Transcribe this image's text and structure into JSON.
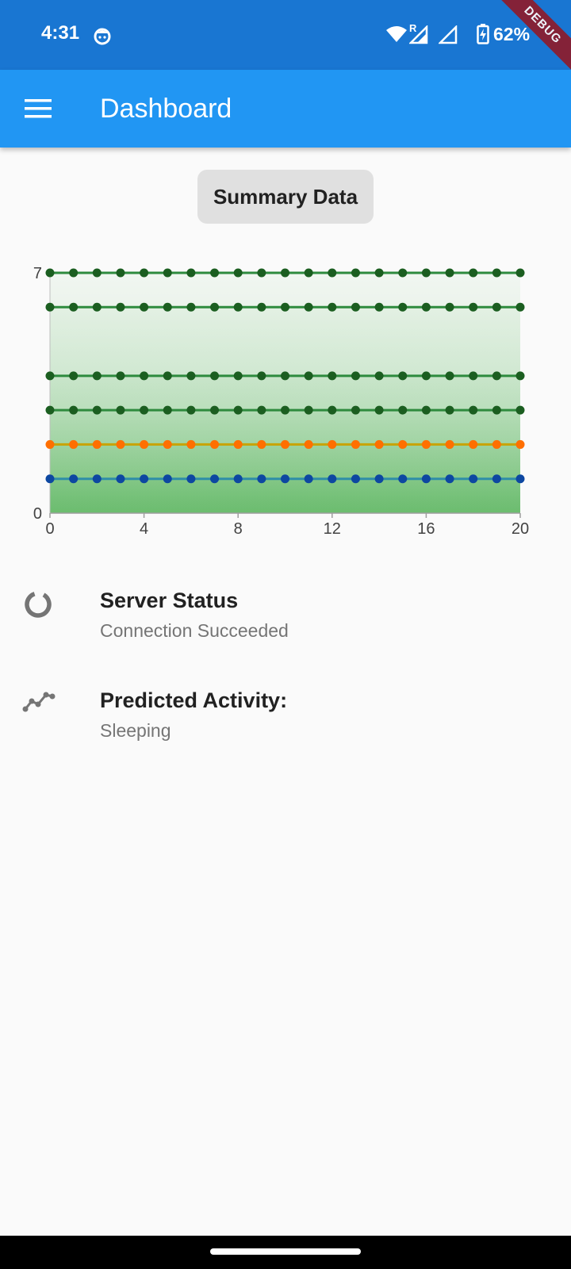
{
  "status_bar": {
    "time": "4:31",
    "battery": "62%",
    "roaming_label": "R",
    "debug_label": "DEBUG",
    "icons": [
      "face-icon",
      "wifi-icon",
      "signal-icon",
      "signal-icon",
      "battery-charging-icon"
    ]
  },
  "app_bar": {
    "title": "Dashboard",
    "menu_icon": "menu-icon",
    "color": "#2196f3"
  },
  "summary_button": {
    "label": "Summary Data"
  },
  "chart_data": {
    "type": "line",
    "x": [
      0,
      1,
      2,
      3,
      4,
      5,
      6,
      7,
      8,
      9,
      10,
      11,
      12,
      13,
      14,
      15,
      16,
      17,
      18,
      19,
      20
    ],
    "xticks": [
      "0",
      "4",
      "8",
      "12",
      "16",
      "20"
    ],
    "yticks": [
      "0",
      "7"
    ],
    "xlim": [
      0,
      20
    ],
    "ylim": [
      0,
      7
    ],
    "area_fill": true,
    "series": [
      {
        "value": 7,
        "color": "#2e8b3e",
        "marker": "#1b5e20"
      },
      {
        "value": 6,
        "color": "#2e8b3e",
        "marker": "#1b5e20"
      },
      {
        "value": 4,
        "color": "#2e8b3e",
        "marker": "#1b5e20"
      },
      {
        "value": 3,
        "color": "#2e8b3e",
        "marker": "#1b5e20"
      },
      {
        "value": 2,
        "color": "#c9a300",
        "marker": "#ff6f00"
      },
      {
        "value": 1,
        "color": "#2f8ea8",
        "marker": "#0d47a1"
      }
    ]
  },
  "server_status": {
    "title": "Server Status",
    "subtitle": "Connection Succeeded",
    "icon": "loading-ring-icon"
  },
  "predicted_activity": {
    "title": "Predicted Activity:",
    "subtitle": "Sleeping",
    "icon": "trend-line-icon"
  }
}
